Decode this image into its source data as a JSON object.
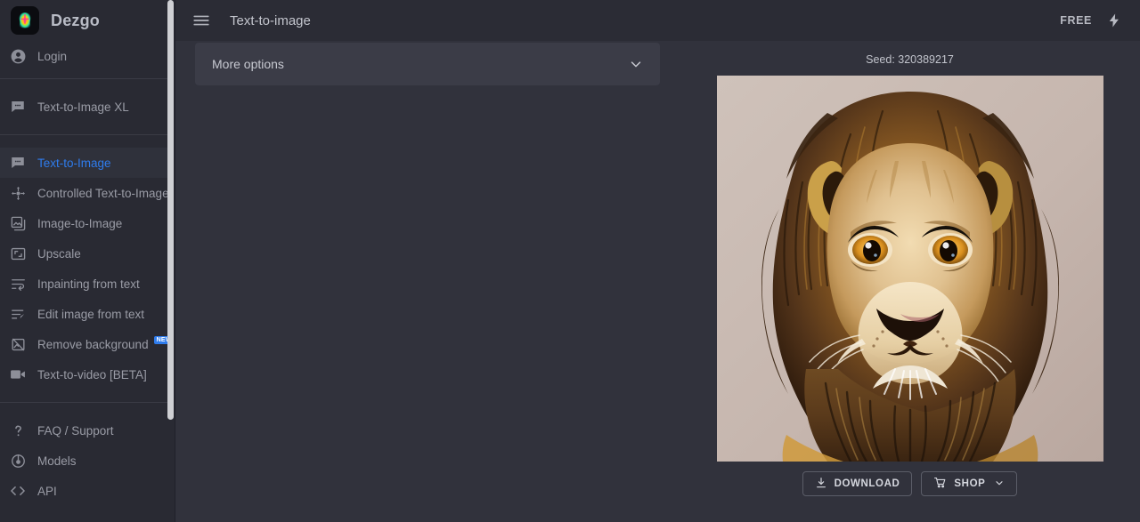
{
  "brand": {
    "name": "Dezgo",
    "logo_icon": "brain-logo-icon"
  },
  "sidebar": {
    "account": {
      "label": "Login",
      "icon": "account-circle-icon"
    },
    "group_one": [
      {
        "label": "Text-to-Image XL",
        "icon": "chat-bubble-icon",
        "active": false
      }
    ],
    "group_two": [
      {
        "label": "Text-to-Image",
        "icon": "chat-bubble-icon",
        "active": true
      },
      {
        "label": "Controlled Text-to-Image",
        "icon": "move-arrows-icon",
        "active": false
      },
      {
        "label": "Image-to-Image",
        "icon": "image-stack-icon",
        "active": false
      },
      {
        "label": "Upscale",
        "icon": "expand-corners-icon",
        "active": false
      },
      {
        "label": "Inpainting from text",
        "icon": "inpaint-lines-icon",
        "active": false
      },
      {
        "label": "Edit image from text",
        "icon": "edit-lines-icon",
        "active": false
      },
      {
        "label": "Remove background",
        "icon": "image-slash-icon",
        "active": false,
        "badge": "NEW"
      },
      {
        "label": "Text-to-video [BETA]",
        "icon": "video-camera-icon",
        "active": false
      }
    ],
    "group_three": [
      {
        "label": "FAQ / Support",
        "icon": "question-mark-icon",
        "active": false
      },
      {
        "label": "Models",
        "icon": "models-node-icon",
        "active": false
      },
      {
        "label": "API",
        "icon": "code-brackets-icon",
        "active": false
      }
    ]
  },
  "topbar": {
    "menu_icon": "hamburger-menu-icon",
    "title": "Text-to-image",
    "plan_label": "FREE",
    "bolt_icon": "lightning-bolt-icon"
  },
  "options_panel": {
    "label": "More options",
    "chevron_icon": "chevron-down-icon"
  },
  "result": {
    "seed_label": "Seed: 320389217",
    "image_alt": "lion-portrait-image",
    "buttons": [
      {
        "label": "DOWNLOAD",
        "icon": "download-icon",
        "name": "download-button"
      },
      {
        "label": "SHOP",
        "icon": "shopping-cart-icon",
        "name": "shop-button",
        "chevron": true
      }
    ]
  },
  "colors": {
    "sidebar_bg": "#292a33",
    "main_bg": "#31323c",
    "topbar_bg": "#2b2c35",
    "panel_bg": "#3b3c47",
    "accent_blue": "#2f7ced",
    "text_muted": "#9a9ca6",
    "image_bg": "#c8b9b1"
  }
}
